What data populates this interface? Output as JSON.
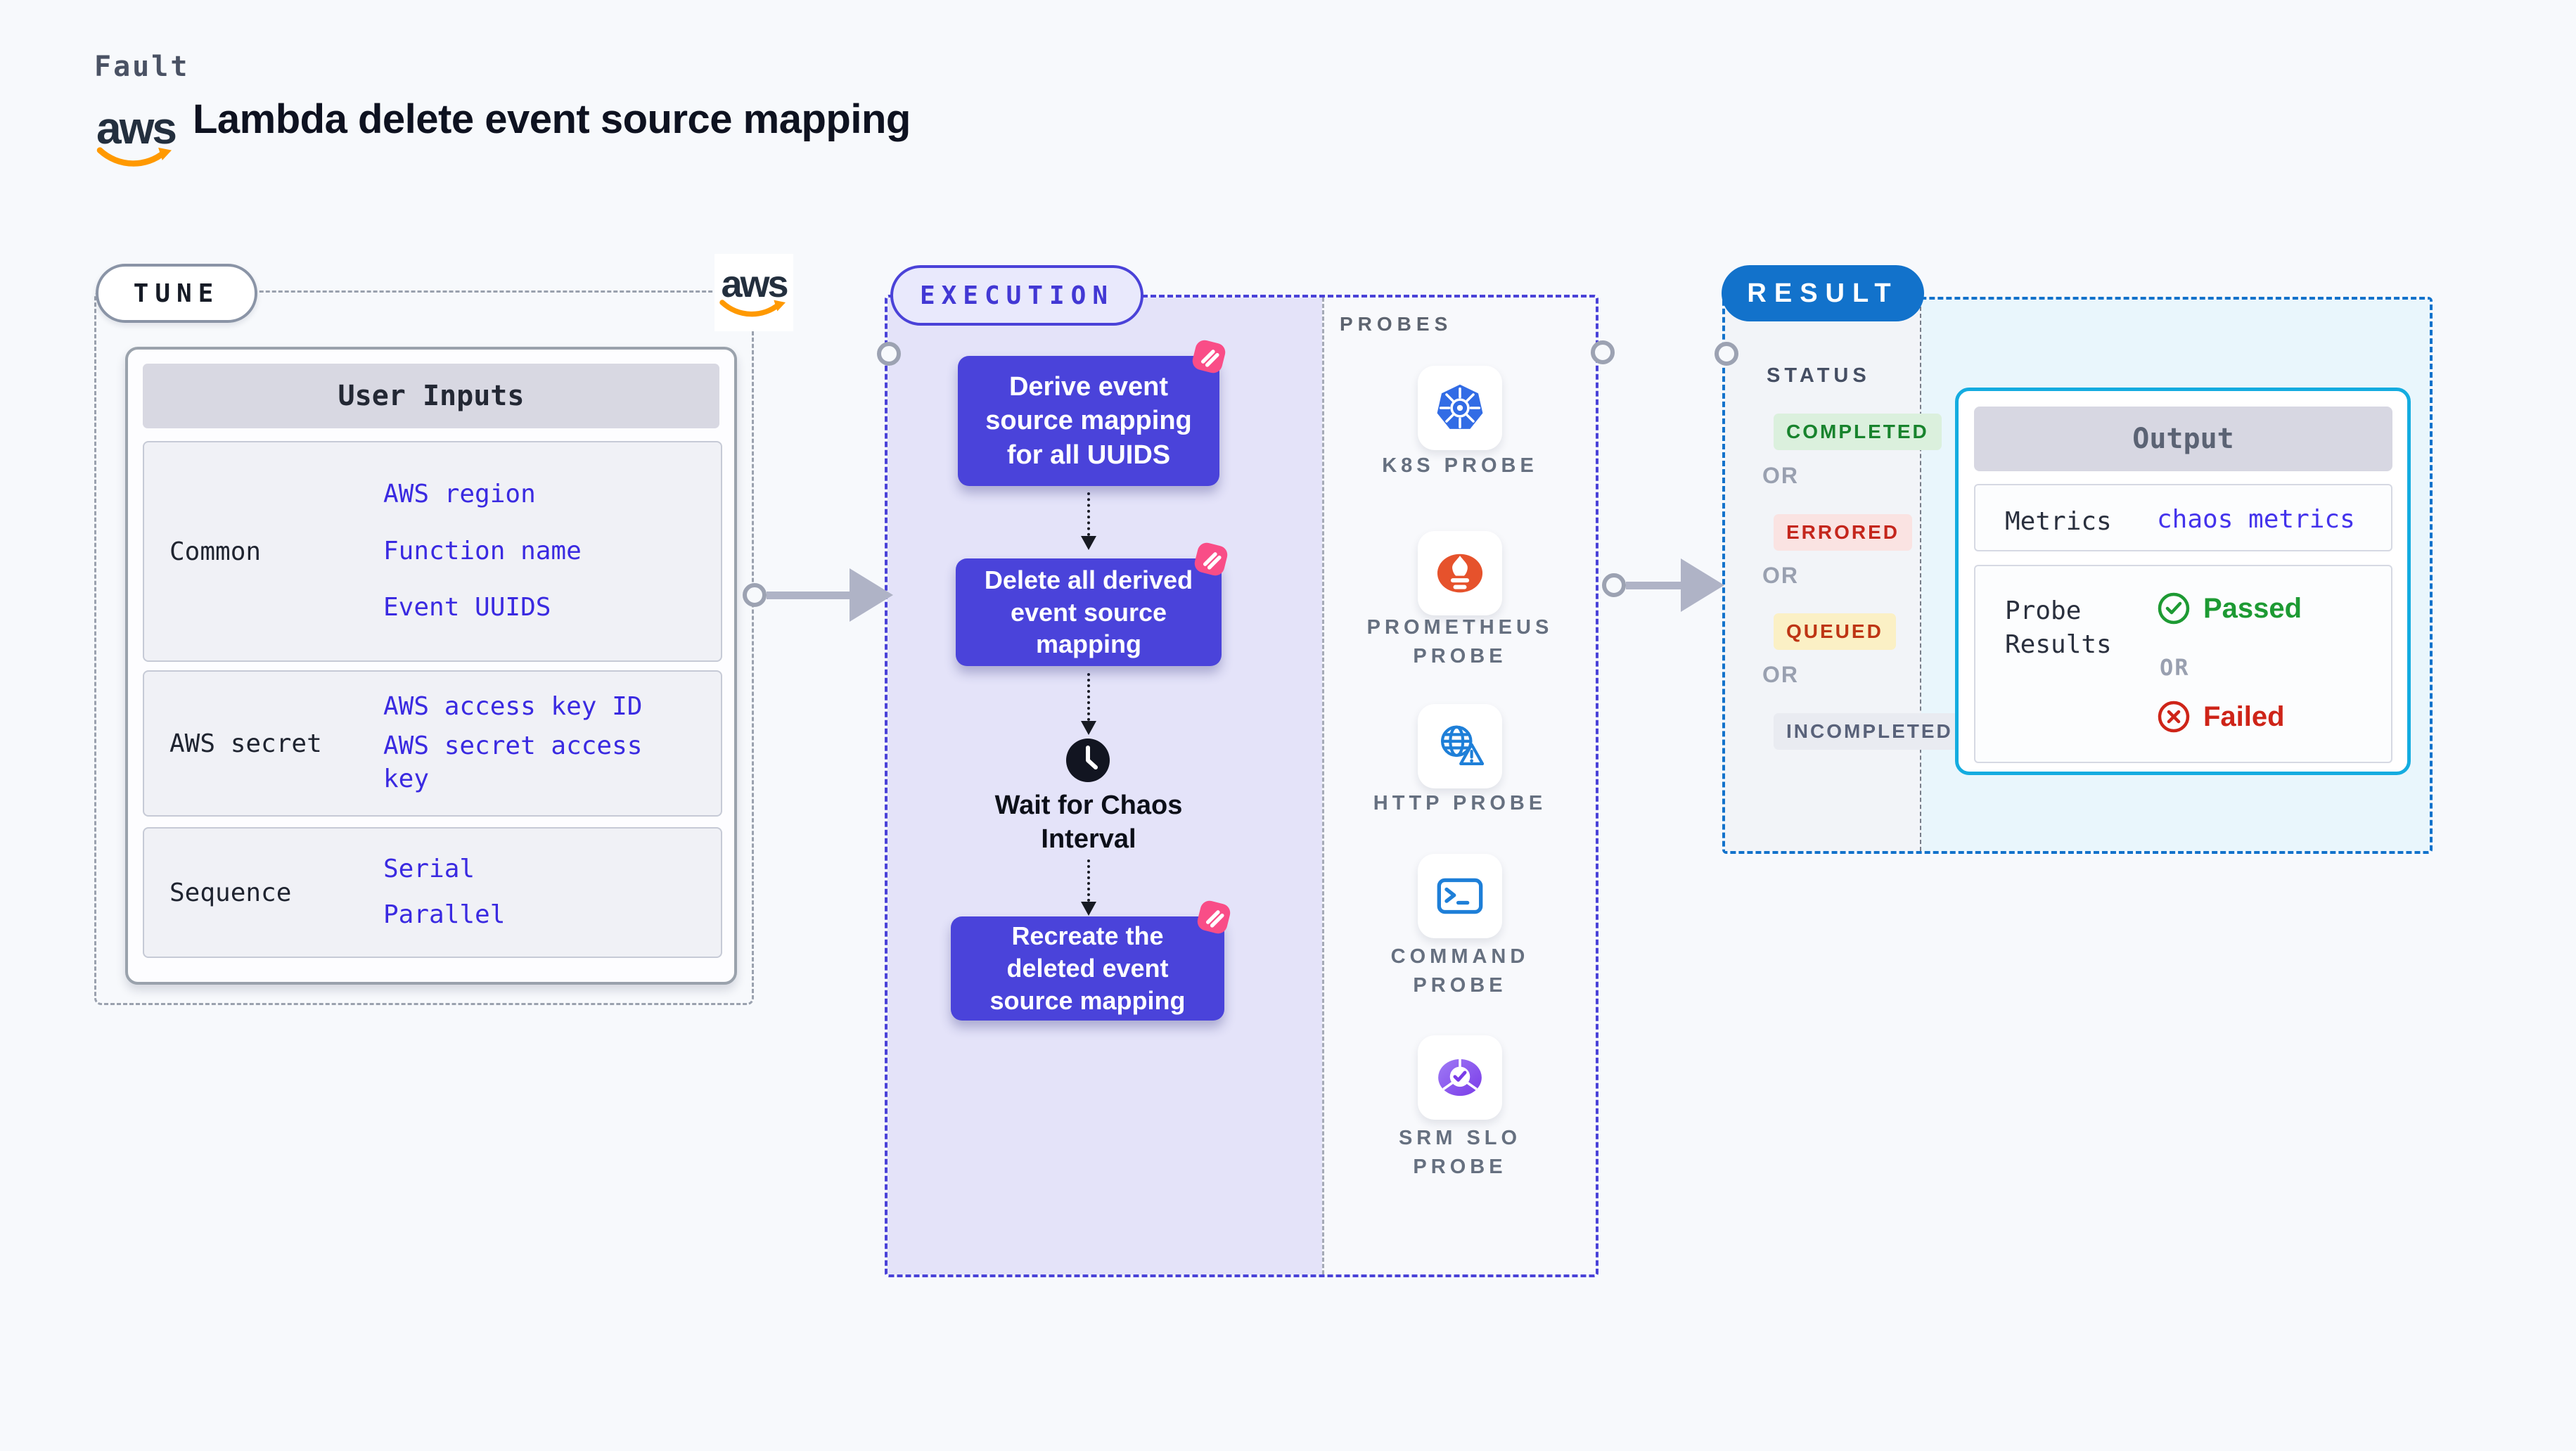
{
  "header": {
    "eyebrow": "Fault",
    "title": "Lambda delete event source mapping",
    "aws_word": "aws"
  },
  "tune": {
    "badge": "TUNE",
    "user_inputs": {
      "header": "User Inputs",
      "rows": [
        {
          "label": "Common",
          "links": [
            "AWS region",
            "Function name",
            "Event UUIDS"
          ]
        },
        {
          "label": "AWS secret",
          "links": [
            "AWS access key ID",
            "AWS secret access key"
          ]
        },
        {
          "label": "Sequence",
          "links": [
            "Serial",
            "Parallel"
          ]
        }
      ]
    }
  },
  "execution": {
    "badge": "EXECUTION",
    "nodes": [
      "Derive event source mapping for all UUIDS",
      "Delete all derived event source mapping",
      "Recreate the deleted event source mapping"
    ],
    "wait_step": "Wait for Chaos Interval",
    "probes": {
      "title": "PROBES",
      "items": [
        {
          "label": "K8S PROBE",
          "icon": "kubernetes-icon"
        },
        {
          "label": "PROMETHEUS PROBE",
          "icon": "prometheus-icon"
        },
        {
          "label": "HTTP PROBE",
          "icon": "http-globe-icon"
        },
        {
          "label": "COMMAND PROBE",
          "icon": "terminal-icon"
        },
        {
          "label": "SRM SLO PROBE",
          "icon": "srm-slo-icon"
        }
      ]
    }
  },
  "result": {
    "badge": "RESULT",
    "status": {
      "title": "STATUS",
      "or": "OR",
      "badges": [
        {
          "label": "COMPLETED",
          "text_color": "#18832D",
          "bg": "#DBF0DD"
        },
        {
          "label": "ERRORED",
          "text_color": "#C4261C",
          "bg": "#FAE3E2"
        },
        {
          "label": "QUEUED",
          "text_color": "#BE3514",
          "bg": "#FBF0C5"
        },
        {
          "label": "INCOMPLETED",
          "text_color": "#59627A",
          "bg": "#E9EBF1"
        }
      ]
    },
    "output": {
      "header": "Output",
      "metrics_label": "Metrics",
      "metrics_value": "chaos metrics",
      "probe_results_label": "Probe Results",
      "passed": "Passed",
      "or": "OR",
      "failed": "Failed"
    }
  },
  "colors": {
    "page_bg": "#F7F9FC",
    "node_purple": "#4A43DA",
    "execution_fill": "#E4E3F9",
    "execution_border": "#4A42D8",
    "result_border": "#1272CB",
    "result_fill": "#E9F6FC",
    "output_border": "#14ACE0",
    "link_blue": "#3A2AE1",
    "fault_pink": "#F94D87",
    "aws_orange": "#FF9900",
    "aws_navy": "#232F3E",
    "passed_green": "#1D9A33",
    "failed_red": "#CE2418"
  }
}
